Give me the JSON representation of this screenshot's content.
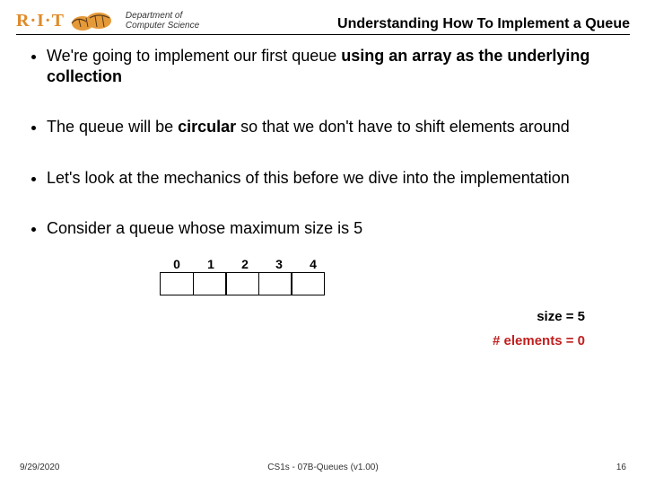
{
  "header": {
    "rit_text": "R·I·T",
    "dept_line1": "Department of",
    "dept_line2": "Computer Science",
    "slide_title": "Understanding How To Implement a Queue"
  },
  "bullets": {
    "b1_pre": "We're going to implement our first queue ",
    "b1_bold": "using an array as the underlying collection",
    "b2_pre": "The queue will be ",
    "b2_bold": "circular",
    "b2_post": " so that we don't have to shift elements around",
    "b3": "Let's look at the mechanics of this before we dive into the implementation",
    "b4": "Consider a queue whose maximum size is 5"
  },
  "queue": {
    "indices": [
      "0",
      "1",
      "2",
      "3",
      "4"
    ],
    "size_label": "size = ",
    "size_value": "5",
    "elements_label": "# elements = ",
    "elements_value": "0"
  },
  "footer": {
    "date": "9/29/2020",
    "center": "CS1s - 07B-Queues (v1.00)",
    "page": "16"
  }
}
